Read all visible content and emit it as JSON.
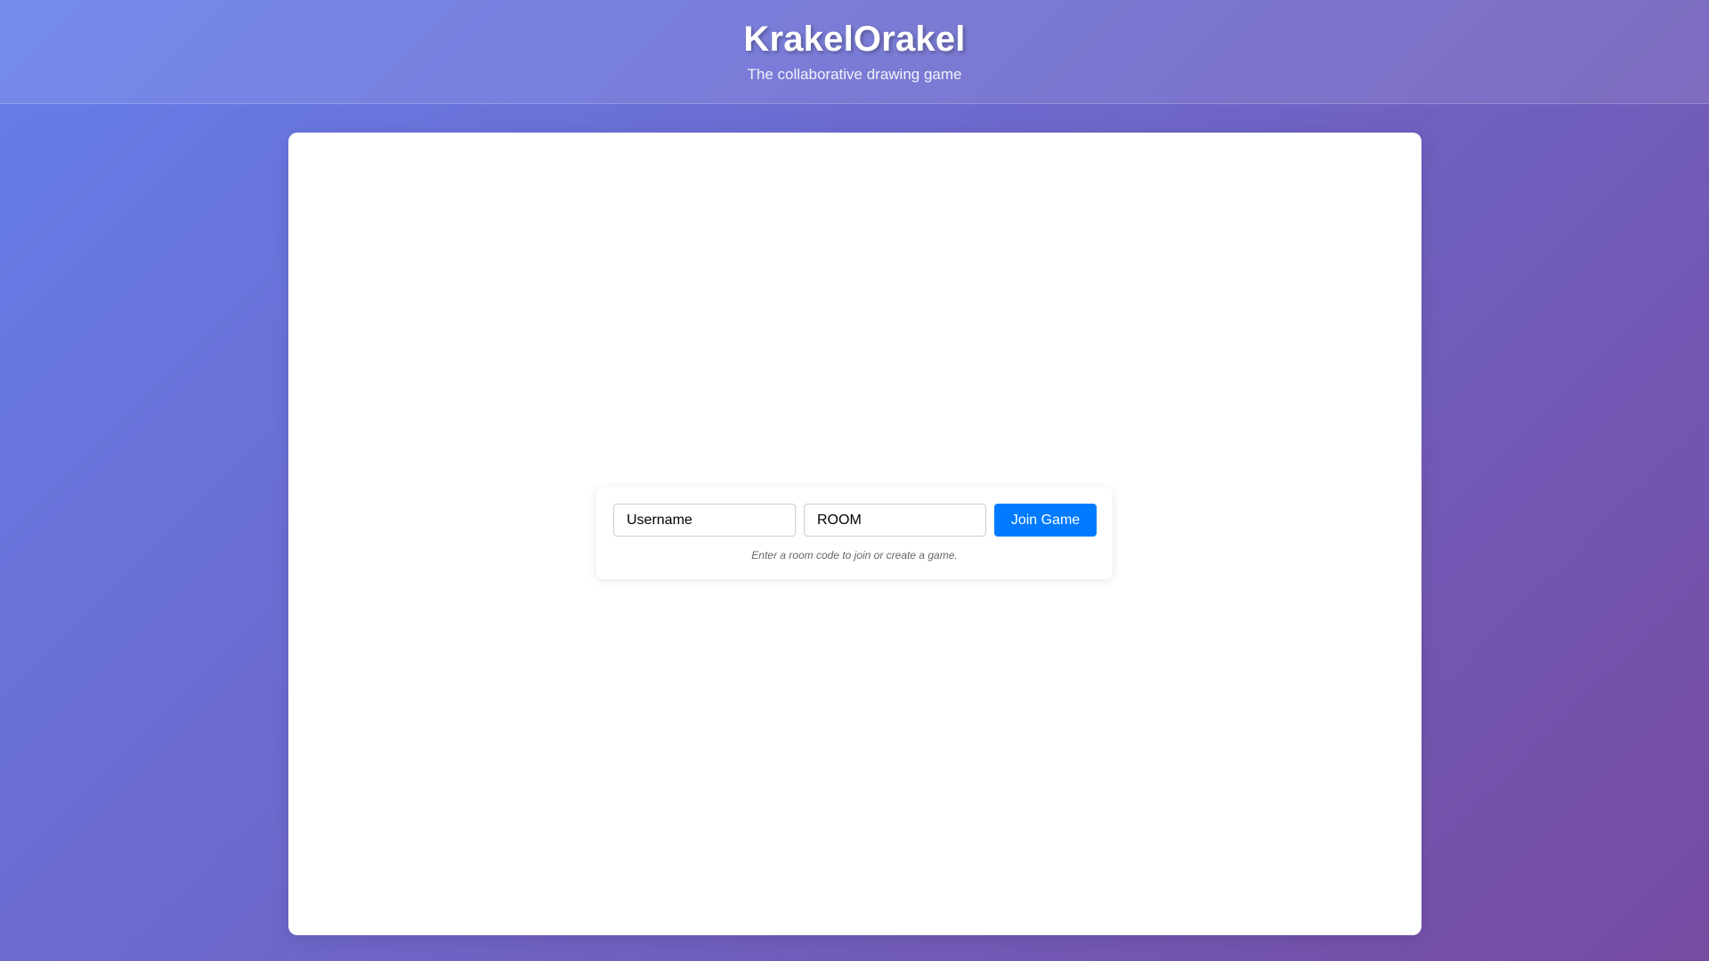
{
  "header": {
    "title": "KrakelOrakel",
    "subtitle": "The collaborative drawing game"
  },
  "join": {
    "username_placeholder": "Username",
    "username_value": "",
    "room_placeholder": "ROOM",
    "room_value": "",
    "button_label": "Join Game",
    "hint": "Enter a room code to join or create a game."
  },
  "colors": {
    "gradient_start": "#667eea",
    "gradient_end": "#764ba2",
    "accent": "#007bff",
    "panel": "#ffffff"
  }
}
